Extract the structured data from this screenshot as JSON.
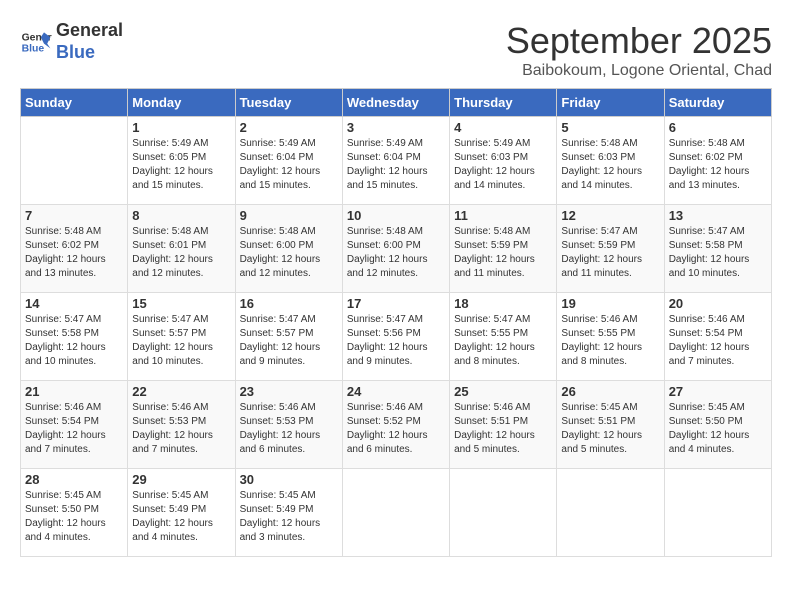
{
  "header": {
    "logo_line1": "General",
    "logo_line2": "Blue",
    "month": "September 2025",
    "location": "Baibokoum, Logone Oriental, Chad"
  },
  "days_of_week": [
    "Sunday",
    "Monday",
    "Tuesday",
    "Wednesday",
    "Thursday",
    "Friday",
    "Saturday"
  ],
  "weeks": [
    [
      {
        "day": "",
        "content": ""
      },
      {
        "day": "1",
        "content": "Sunrise: 5:49 AM\nSunset: 6:05 PM\nDaylight: 12 hours\nand 15 minutes."
      },
      {
        "day": "2",
        "content": "Sunrise: 5:49 AM\nSunset: 6:04 PM\nDaylight: 12 hours\nand 15 minutes."
      },
      {
        "day": "3",
        "content": "Sunrise: 5:49 AM\nSunset: 6:04 PM\nDaylight: 12 hours\nand 15 minutes."
      },
      {
        "day": "4",
        "content": "Sunrise: 5:49 AM\nSunset: 6:03 PM\nDaylight: 12 hours\nand 14 minutes."
      },
      {
        "day": "5",
        "content": "Sunrise: 5:48 AM\nSunset: 6:03 PM\nDaylight: 12 hours\nand 14 minutes."
      },
      {
        "day": "6",
        "content": "Sunrise: 5:48 AM\nSunset: 6:02 PM\nDaylight: 12 hours\nand 13 minutes."
      }
    ],
    [
      {
        "day": "7",
        "content": "Sunrise: 5:48 AM\nSunset: 6:02 PM\nDaylight: 12 hours\nand 13 minutes."
      },
      {
        "day": "8",
        "content": "Sunrise: 5:48 AM\nSunset: 6:01 PM\nDaylight: 12 hours\nand 12 minutes."
      },
      {
        "day": "9",
        "content": "Sunrise: 5:48 AM\nSunset: 6:00 PM\nDaylight: 12 hours\nand 12 minutes."
      },
      {
        "day": "10",
        "content": "Sunrise: 5:48 AM\nSunset: 6:00 PM\nDaylight: 12 hours\nand 12 minutes."
      },
      {
        "day": "11",
        "content": "Sunrise: 5:48 AM\nSunset: 5:59 PM\nDaylight: 12 hours\nand 11 minutes."
      },
      {
        "day": "12",
        "content": "Sunrise: 5:47 AM\nSunset: 5:59 PM\nDaylight: 12 hours\nand 11 minutes."
      },
      {
        "day": "13",
        "content": "Sunrise: 5:47 AM\nSunset: 5:58 PM\nDaylight: 12 hours\nand 10 minutes."
      }
    ],
    [
      {
        "day": "14",
        "content": "Sunrise: 5:47 AM\nSunset: 5:58 PM\nDaylight: 12 hours\nand 10 minutes."
      },
      {
        "day": "15",
        "content": "Sunrise: 5:47 AM\nSunset: 5:57 PM\nDaylight: 12 hours\nand 10 minutes."
      },
      {
        "day": "16",
        "content": "Sunrise: 5:47 AM\nSunset: 5:57 PM\nDaylight: 12 hours\nand 9 minutes."
      },
      {
        "day": "17",
        "content": "Sunrise: 5:47 AM\nSunset: 5:56 PM\nDaylight: 12 hours\nand 9 minutes."
      },
      {
        "day": "18",
        "content": "Sunrise: 5:47 AM\nSunset: 5:55 PM\nDaylight: 12 hours\nand 8 minutes."
      },
      {
        "day": "19",
        "content": "Sunrise: 5:46 AM\nSunset: 5:55 PM\nDaylight: 12 hours\nand 8 minutes."
      },
      {
        "day": "20",
        "content": "Sunrise: 5:46 AM\nSunset: 5:54 PM\nDaylight: 12 hours\nand 7 minutes."
      }
    ],
    [
      {
        "day": "21",
        "content": "Sunrise: 5:46 AM\nSunset: 5:54 PM\nDaylight: 12 hours\nand 7 minutes."
      },
      {
        "day": "22",
        "content": "Sunrise: 5:46 AM\nSunset: 5:53 PM\nDaylight: 12 hours\nand 7 minutes."
      },
      {
        "day": "23",
        "content": "Sunrise: 5:46 AM\nSunset: 5:53 PM\nDaylight: 12 hours\nand 6 minutes."
      },
      {
        "day": "24",
        "content": "Sunrise: 5:46 AM\nSunset: 5:52 PM\nDaylight: 12 hours\nand 6 minutes."
      },
      {
        "day": "25",
        "content": "Sunrise: 5:46 AM\nSunset: 5:51 PM\nDaylight: 12 hours\nand 5 minutes."
      },
      {
        "day": "26",
        "content": "Sunrise: 5:45 AM\nSunset: 5:51 PM\nDaylight: 12 hours\nand 5 minutes."
      },
      {
        "day": "27",
        "content": "Sunrise: 5:45 AM\nSunset: 5:50 PM\nDaylight: 12 hours\nand 4 minutes."
      }
    ],
    [
      {
        "day": "28",
        "content": "Sunrise: 5:45 AM\nSunset: 5:50 PM\nDaylight: 12 hours\nand 4 minutes."
      },
      {
        "day": "29",
        "content": "Sunrise: 5:45 AM\nSunset: 5:49 PM\nDaylight: 12 hours\nand 4 minutes."
      },
      {
        "day": "30",
        "content": "Sunrise: 5:45 AM\nSunset: 5:49 PM\nDaylight: 12 hours\nand 3 minutes."
      },
      {
        "day": "",
        "content": ""
      },
      {
        "day": "",
        "content": ""
      },
      {
        "day": "",
        "content": ""
      },
      {
        "day": "",
        "content": ""
      }
    ]
  ]
}
